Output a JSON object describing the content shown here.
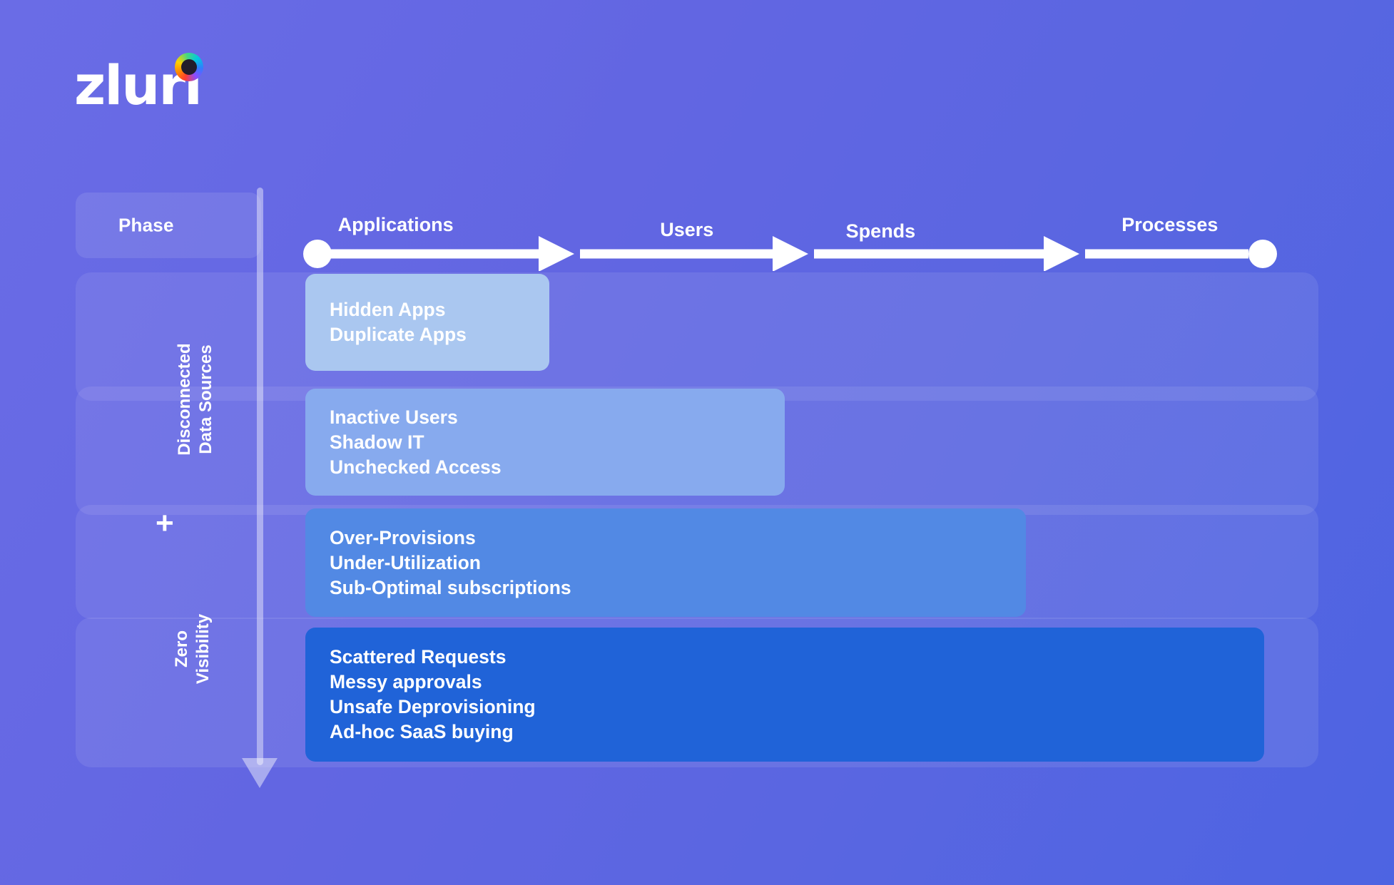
{
  "brand": {
    "name": "zluri",
    "logo_dot_icon": "rainbow-dot-icon"
  },
  "header": {
    "phase_label": "Phase"
  },
  "timeline": {
    "start_marker_icon": "circle-marker-icon",
    "end_marker_icon": "circle-marker-icon",
    "arrow_icon": "arrow-right-icon",
    "stages": [
      {
        "label": "Applications",
        "x_pct": 9.5,
        "label_y": 0
      },
      {
        "label": "Users",
        "x_pct": 39.4,
        "label_y": 7
      },
      {
        "label": "Spends",
        "x_pct": 59.3,
        "label_y": 9
      },
      {
        "label": "Processes",
        "x_pct": 89.0,
        "label_y": 0
      }
    ]
  },
  "side_labels": {
    "top": "Disconnected\nData Sources",
    "plus": "+",
    "bottom": "Zero\nVisibility"
  },
  "rows": [
    {
      "id": "applications",
      "stage": "Applications",
      "color": "#aac7f0",
      "items": [
        "Hidden Apps",
        "Duplicate Apps"
      ]
    },
    {
      "id": "users",
      "stage": "Users",
      "color": "#87aaee",
      "items": [
        "Inactive Users",
        "Shadow IT",
        "Unchecked Access"
      ]
    },
    {
      "id": "spends",
      "stage": "Spends",
      "color": "#5289e4",
      "items": [
        "Over-Provisions",
        "Under-Utilization",
        "Sub-Optimal subscriptions"
      ]
    },
    {
      "id": "processes",
      "stage": "Processes",
      "color": "#2063d8",
      "items": [
        "Scattered Requests",
        "Messy approvals",
        "Unsafe Deprovisioning",
        "Ad-hoc SaaS buying"
      ]
    }
  ],
  "colors": {
    "background_start": "#6a6ce6",
    "background_end": "#4d64e2",
    "panel_overlay": "rgba(255,255,255,0.085)",
    "axis": "rgba(255,255,255,0.42)",
    "text": "#ffffff"
  },
  "vertical_arrow_icon": "arrow-down-icon"
}
